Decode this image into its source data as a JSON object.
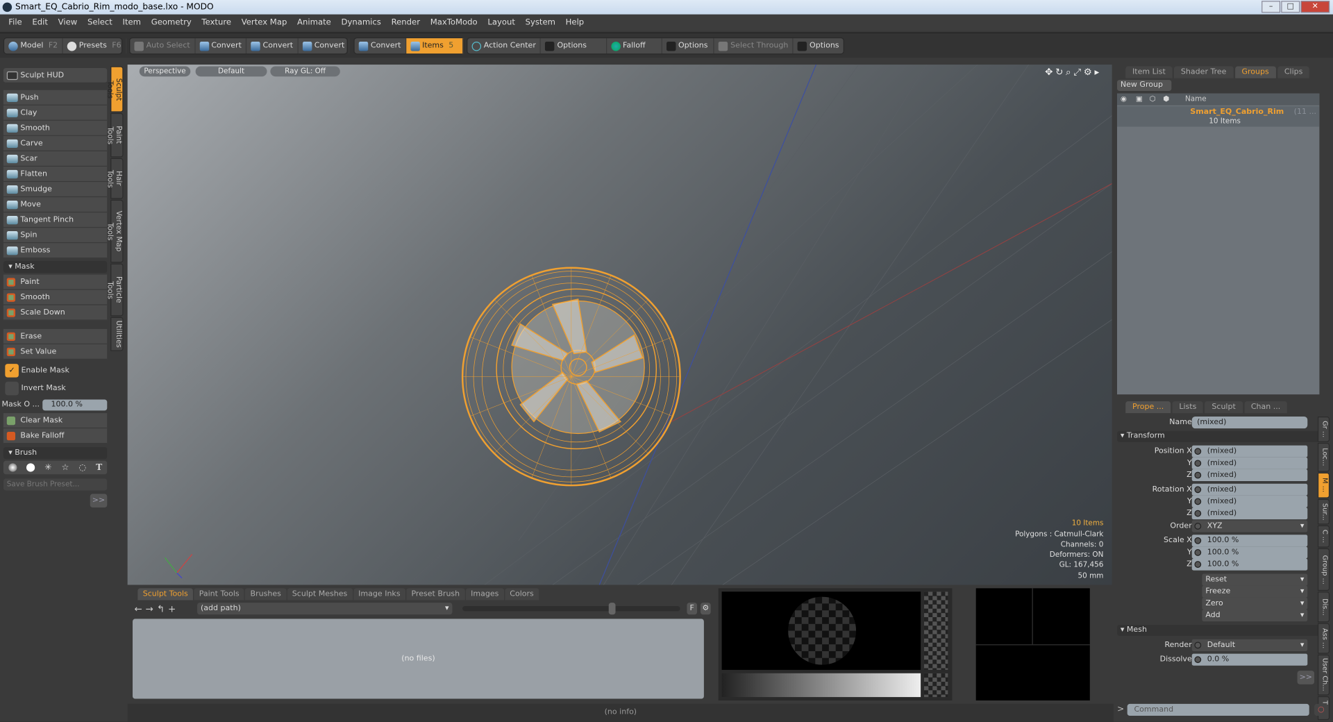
{
  "window": {
    "title": "Smart_EQ_Cabrio_Rim_modo_base.lxo - MODO",
    "controls": [
      "–",
      "□",
      "✕"
    ]
  },
  "menu": [
    "File",
    "Edit",
    "View",
    "Select",
    "Item",
    "Geometry",
    "Texture",
    "Vertex Map",
    "Animate",
    "Dynamics",
    "Render",
    "MaxToModo",
    "Layout",
    "System",
    "Help"
  ],
  "toolbar": {
    "model": "Model",
    "model_key": "F2",
    "presets": "Presets",
    "presets_key": "F6",
    "auto_select": "Auto Select",
    "convert1": "Convert",
    "convert2": "Convert",
    "convert3": "Convert",
    "convert4": "Convert",
    "items": "Items",
    "items_key": "5",
    "action_center": "Action Center",
    "options1": "Options",
    "falloff": "Falloff",
    "options2": "Options",
    "select_through": "Select Through",
    "options3": "Options",
    "accent": "#f0a030"
  },
  "left": {
    "hud": "Sculpt HUD",
    "tools": [
      "Push",
      "Clay",
      "Smooth",
      "Carve",
      "Scar",
      "Flatten",
      "Smudge",
      "Move",
      "Tangent Pinch",
      "Spin",
      "Emboss"
    ],
    "mask_header": "Mask",
    "mask_tools": [
      "Paint",
      "Smooth",
      "Scale Down"
    ],
    "mask_tools2": [
      "Erase",
      "Set Value"
    ],
    "enable_mask": "Enable Mask",
    "enable_mask_checked": true,
    "invert_mask": "Invert Mask",
    "invert_mask_checked": false,
    "mask_opacity_label": "Mask O ...",
    "mask_opacity_value": "100.0 %",
    "clear_mask": "Clear Mask",
    "bake_falloff": "Bake Falloff",
    "brush_header": "Brush",
    "save_brush_placeholder": "Save Brush Preset...",
    "more": ">>",
    "vtabs": [
      "Sculpt Tools",
      "Paint Tools",
      "Hair Tools",
      "Vertex Map Tools",
      "Particle Tools",
      "Utilities"
    ]
  },
  "viewport": {
    "view": "Perspective",
    "style": "Default",
    "raygl": "Ray GL: Off",
    "info": {
      "items": "10 Items",
      "polygons": "Polygons : Catmull-Clark",
      "channels": "Channels: 0",
      "deformers": "Deformers: ON",
      "gl": "GL: 167,456",
      "scale": "50 mm"
    }
  },
  "bottom": {
    "tabs": [
      "Sculpt Tools",
      "Paint Tools",
      "Brushes",
      "Sculpt Meshes",
      "Image Inks",
      "Preset Brush",
      "Images",
      "Colors"
    ],
    "path": "(add path)",
    "f_button": "F",
    "no_files": "(no files)"
  },
  "status": "(no info)",
  "right": {
    "top_tabs": [
      "Item List",
      "Shader Tree",
      "Groups",
      "Clips"
    ],
    "new_group": "New Group",
    "col_name": "Name",
    "group": {
      "name": "Smart_EQ_Cabrio_Rim",
      "suffix": "(11 ...",
      "count": "10 Items"
    },
    "prop_tabs": [
      "Prope ...",
      "Lists",
      "Sculpt",
      "Chan ..."
    ],
    "name_label": "Name",
    "name_value": "(mixed)",
    "transform": "Transform",
    "position": [
      [
        "Position X",
        "(mixed)"
      ],
      [
        "Y",
        "(mixed)"
      ],
      [
        "Z",
        "(mixed)"
      ]
    ],
    "rotation": [
      [
        "Rotation X",
        "(mixed)"
      ],
      [
        "Y",
        "(mixed)"
      ],
      [
        "Z",
        "(mixed)"
      ]
    ],
    "order_label": "Order",
    "order_value": "XYZ",
    "scale": [
      [
        "Scale X",
        "100.0 %"
      ],
      [
        "Y",
        "100.0 %"
      ],
      [
        "Z",
        "100.0 %"
      ]
    ],
    "actions": [
      "Reset",
      "Freeze",
      "Zero",
      "Add"
    ],
    "mesh": "Mesh",
    "render_label": "Render",
    "render_value": "Default",
    "dissolve_label": "Dissolve",
    "dissolve_value": "0.0 %",
    "more": ">>",
    "side_tabs": [
      "Gr ...",
      "Loc...",
      "M ...",
      "Sur...",
      "C ...",
      "Group ...",
      "Dis...",
      "Ass ...",
      "User Ch...",
      "Tags"
    ],
    "command_placeholder": "Command"
  }
}
